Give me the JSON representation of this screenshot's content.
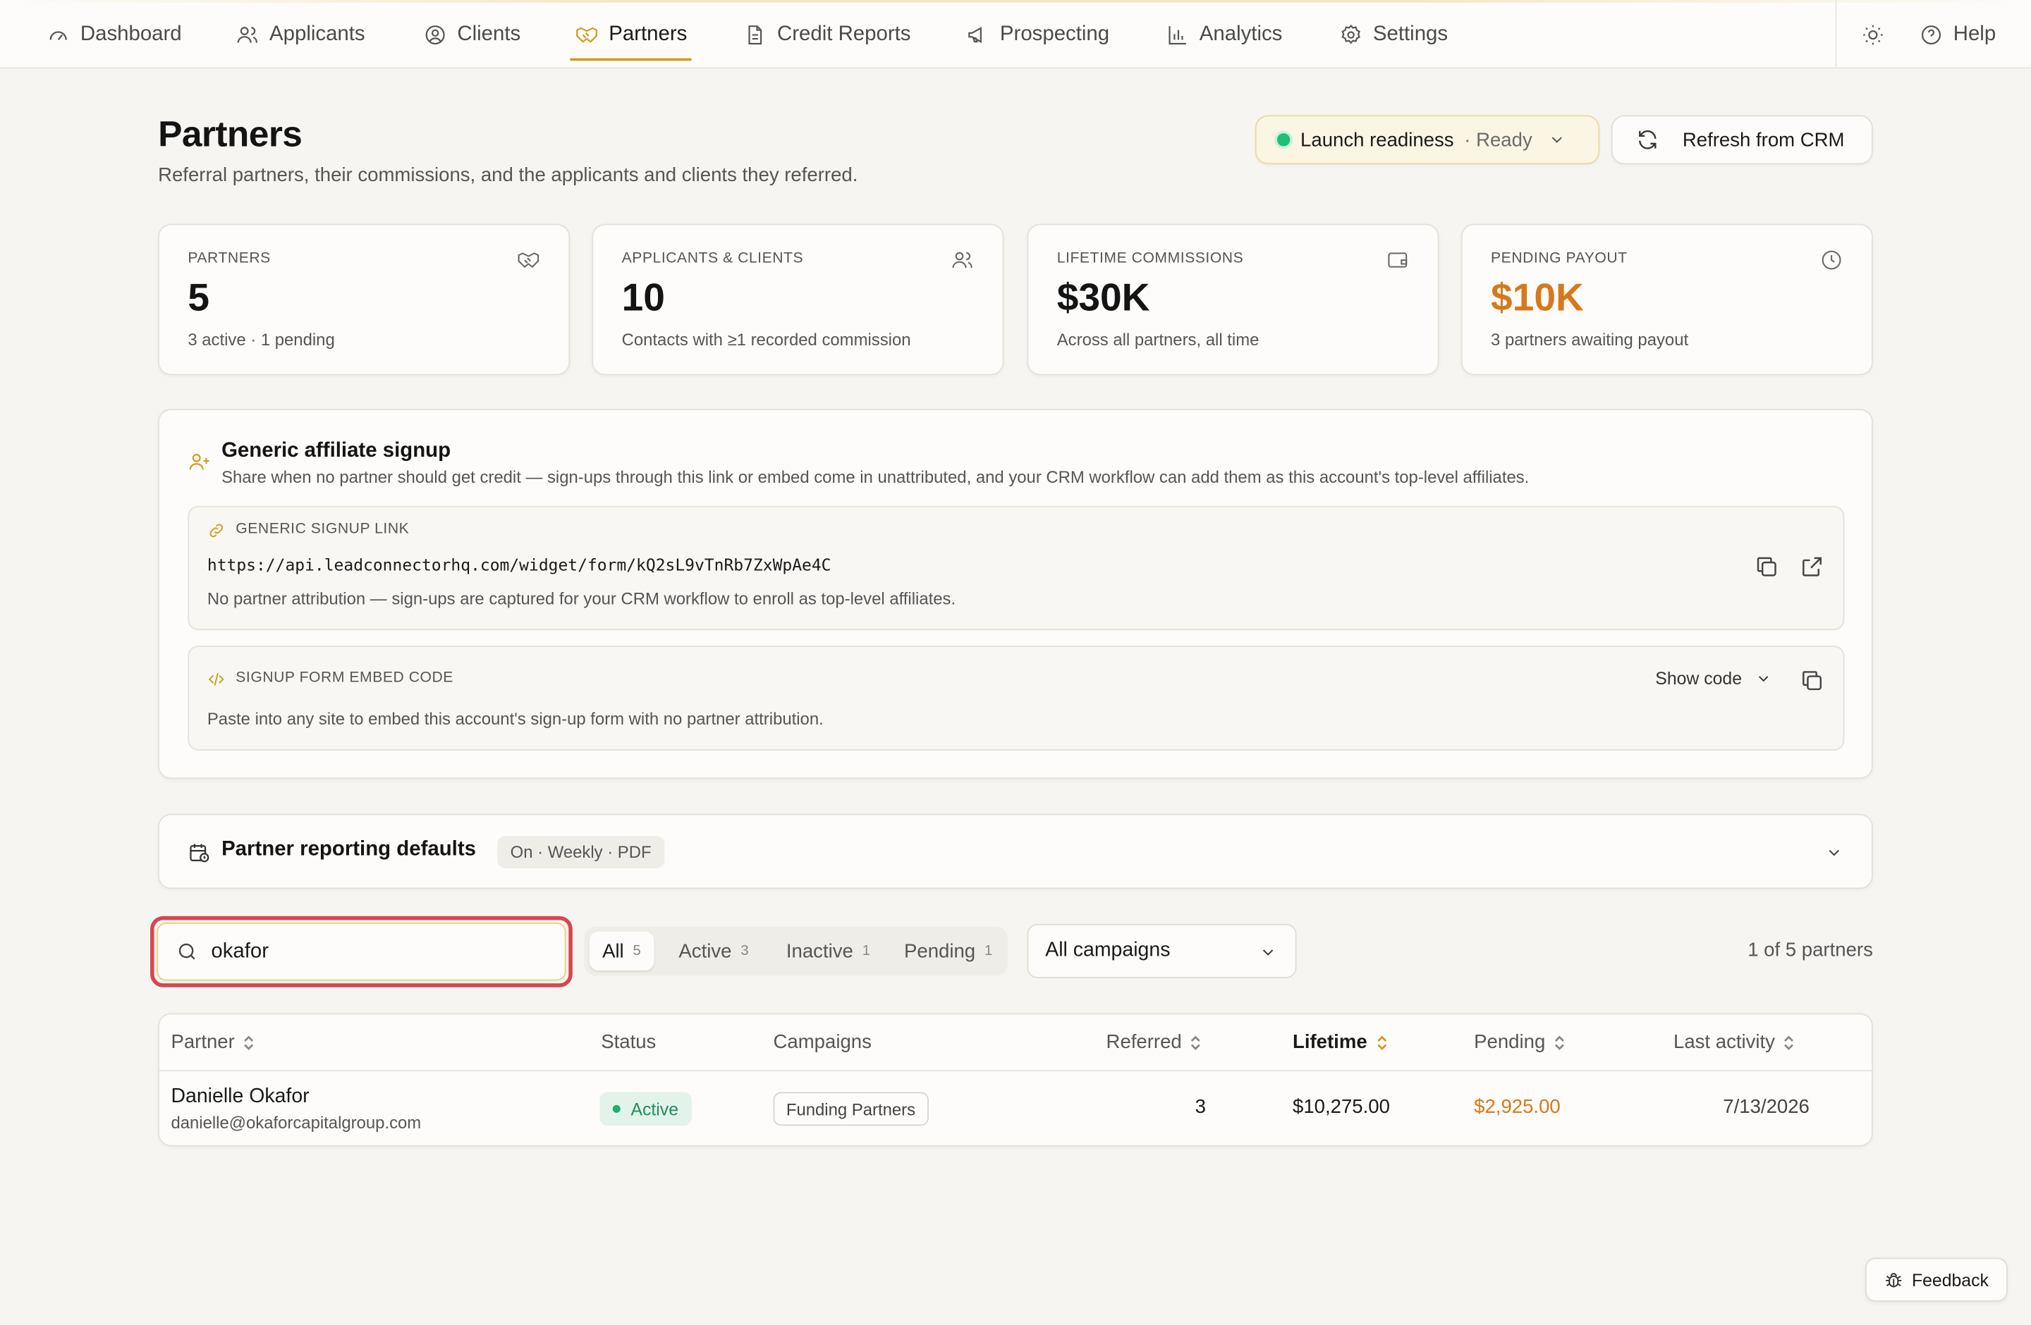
{
  "nav": {
    "items": [
      {
        "label": "Dashboard",
        "icon": "gauge-icon"
      },
      {
        "label": "Applicants",
        "icon": "users-icon"
      },
      {
        "label": "Clients",
        "icon": "user-circle-icon"
      },
      {
        "label": "Partners",
        "icon": "handshake-icon",
        "active": true
      },
      {
        "label": "Credit Reports",
        "icon": "file-text-icon"
      },
      {
        "label": "Prospecting",
        "icon": "megaphone-icon"
      },
      {
        "label": "Analytics",
        "icon": "bar-chart-icon"
      },
      {
        "label": "Settings",
        "icon": "gear-icon"
      }
    ],
    "help_label": "Help",
    "accent_color": "#d49a1a"
  },
  "header": {
    "title": "Partners",
    "subtitle": "Referral partners, their commissions, and the applicants and clients they referred.",
    "launch_label": "Launch readiness",
    "launch_status": "· Ready",
    "refresh_label": "Refresh from CRM"
  },
  "stats": [
    {
      "label": "PARTNERS",
      "value": "5",
      "note": "3 active · 1 pending",
      "icon": "handshake-icon"
    },
    {
      "label": "APPLICANTS & CLIENTS",
      "value": "10",
      "note": "Contacts with ≥1 recorded commission",
      "icon": "users-icon"
    },
    {
      "label": "LIFETIME COMMISSIONS",
      "value": "$30K",
      "note": "Across all partners, all time",
      "icon": "wallet-icon"
    },
    {
      "label": "PENDING PAYOUT",
      "value": "$10K",
      "note": "3 partners awaiting payout",
      "icon": "clock-icon",
      "value_color": "#d8781a"
    }
  ],
  "affiliate": {
    "title": "Generic affiliate signup",
    "description": "Share when no partner should get credit — sign-ups through this link or embed come in unattributed, and your CRM workflow can add them as this account's top-level affiliates.",
    "link_caption": "GENERIC SIGNUP LINK",
    "link_url": "https://api.leadconnectorhq.com/widget/form/kQ2sL9vTnRb7ZxWpAe4C",
    "link_hint": "No partner attribution — sign-ups are captured for your CRM workflow to enroll as top-level affiliates.",
    "embed_caption": "SIGNUP FORM EMBED CODE",
    "embed_hint": "Paste into any site to embed this account's sign-up form with no partner attribution.",
    "show_code_label": "Show code"
  },
  "reporting": {
    "title": "Partner reporting defaults",
    "badge": "On · Weekly · PDF"
  },
  "filters": {
    "search_value": "okafor",
    "segments": [
      {
        "label": "All",
        "count": "5",
        "active": true
      },
      {
        "label": "Active",
        "count": "3"
      },
      {
        "label": "Inactive",
        "count": "1"
      },
      {
        "label": "Pending",
        "count": "1"
      }
    ],
    "campaign_select": "All campaigns",
    "result_count": "1 of 5 partners"
  },
  "table": {
    "columns": [
      "Partner",
      "Status",
      "Campaigns",
      "Referred",
      "Lifetime",
      "Pending",
      "Last activity"
    ],
    "rows": [
      {
        "name": "Danielle Okafor",
        "email": "danielle@okaforcapitalgroup.com",
        "status": "Active",
        "campaign": "Funding Partners",
        "referred": "3",
        "lifetime": "$10,275.00",
        "pending": "$2,925.00",
        "last_activity": "7/13/2026"
      }
    ],
    "pending_color": "#d8781a"
  },
  "feedback_label": "Feedback"
}
